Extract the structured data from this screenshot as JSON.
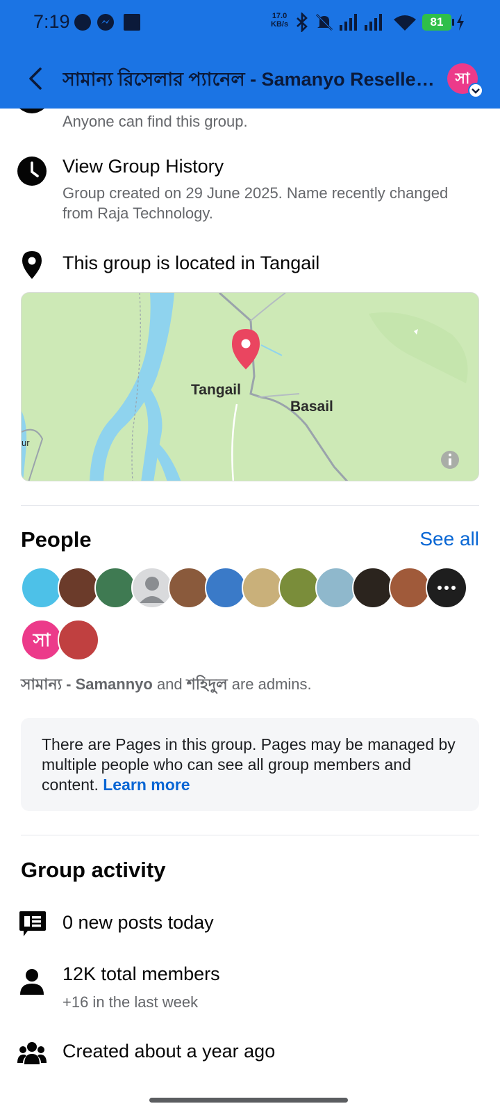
{
  "status_bar": {
    "time": "7:19",
    "net_speed_value": "17.0",
    "net_speed_unit": "KB/s",
    "battery": "81",
    "icons": [
      "circle-icon",
      "messenger-icon",
      "square-icon",
      "bluetooth-icon",
      "mute-icon",
      "signal-icon",
      "signal-icon",
      "wifi-icon",
      "battery-icon",
      "charging-icon"
    ]
  },
  "header": {
    "title": "সামান্য রিসেলার প্যানেল - Samanyo Reseller Panel",
    "avatar_letter": "সা"
  },
  "about": {
    "visibility_sub": "Anyone can find this group.",
    "history_title": "View Group History",
    "history_sub": "Group created on 29 June 2025. Name recently changed from Raja Technology.",
    "location_title": "This group is located in Tangail"
  },
  "map": {
    "labels": [
      "Tangail",
      "Basail"
    ],
    "partial_label": "ur"
  },
  "people": {
    "title": "People",
    "see_all": "See all",
    "admin1": "সামান্য - Samannyo",
    "and": " and ",
    "admin2": "শহিদুল",
    "admin_suffix": " are admins.",
    "notice_text": "There are Pages in this group. Pages may be managed by multiple people who can see all group members and content. ",
    "notice_link": "Learn more",
    "avatar_colors": [
      "#4dc1e8",
      "#6b3b2a",
      "#3f7a52",
      "#d9dadc",
      "#8a5a3c",
      "#3a7ac8",
      "#c9b07a",
      "#7a8d3a",
      "#8fb8cc",
      "#2b241e",
      "#a05a3a",
      "#1e1e1e",
      "#ec3a8a",
      "#c04040"
    ]
  },
  "activity": {
    "title": "Group activity",
    "posts": "0 new posts today",
    "members": "12K total members",
    "members_sub": "+16 in the last week",
    "created": "Created about a year ago"
  }
}
